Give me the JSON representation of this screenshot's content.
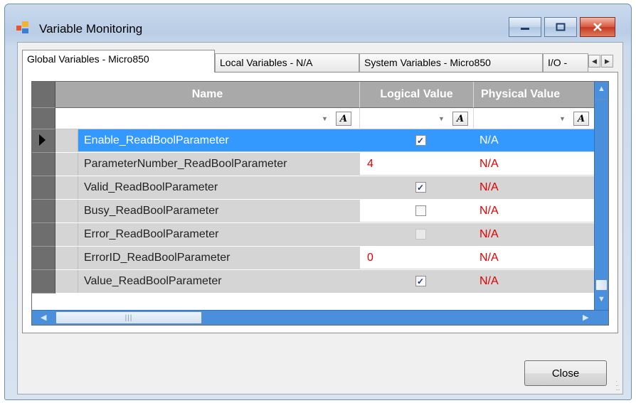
{
  "window": {
    "title": "Variable Monitoring"
  },
  "tabs": [
    {
      "label": "Global Variables - Micro850",
      "active": true
    },
    {
      "label": "Local Variables - N/A",
      "active": false
    },
    {
      "label": "System Variables - Micro850",
      "active": false
    },
    {
      "label": "I/O - ",
      "active": false
    }
  ],
  "grid": {
    "columns": [
      {
        "label": "Name"
      },
      {
        "label": "Logical Value"
      },
      {
        "label": "Physical Value"
      }
    ],
    "rows": [
      {
        "name": "Enable_ReadBoolParameter",
        "logical_type": "checkbox",
        "checked": true,
        "physical": "N/A",
        "selected": true
      },
      {
        "name": "ParameterNumber_ReadBoolParameter",
        "logical_type": "text",
        "logical": "4",
        "physical": "N/A",
        "selected": false
      },
      {
        "name": "Valid_ReadBoolParameter",
        "logical_type": "checkbox",
        "checked": true,
        "physical": "N/A",
        "selected": false
      },
      {
        "name": "Busy_ReadBoolParameter",
        "logical_type": "checkbox",
        "checked": false,
        "physical": "N/A",
        "selected": false
      },
      {
        "name": "Error_ReadBoolParameter",
        "logical_type": "checkbox",
        "checked": false,
        "disabled": true,
        "physical": "N/A",
        "selected": false
      },
      {
        "name": "ErrorID_ReadBoolParameter",
        "logical_type": "text",
        "logical": "0",
        "physical": "N/A",
        "selected": false
      },
      {
        "name": "Value_ReadBoolParameter",
        "logical_type": "checkbox",
        "checked": true,
        "physical": "N/A",
        "selected": false
      }
    ]
  },
  "buttons": {
    "close": "Close"
  },
  "colors": {
    "selection": "#3399ff",
    "value_red": "#e00000",
    "header_gray": "#a9a9a9",
    "scrollbar_blue": "#4a8fdb"
  }
}
